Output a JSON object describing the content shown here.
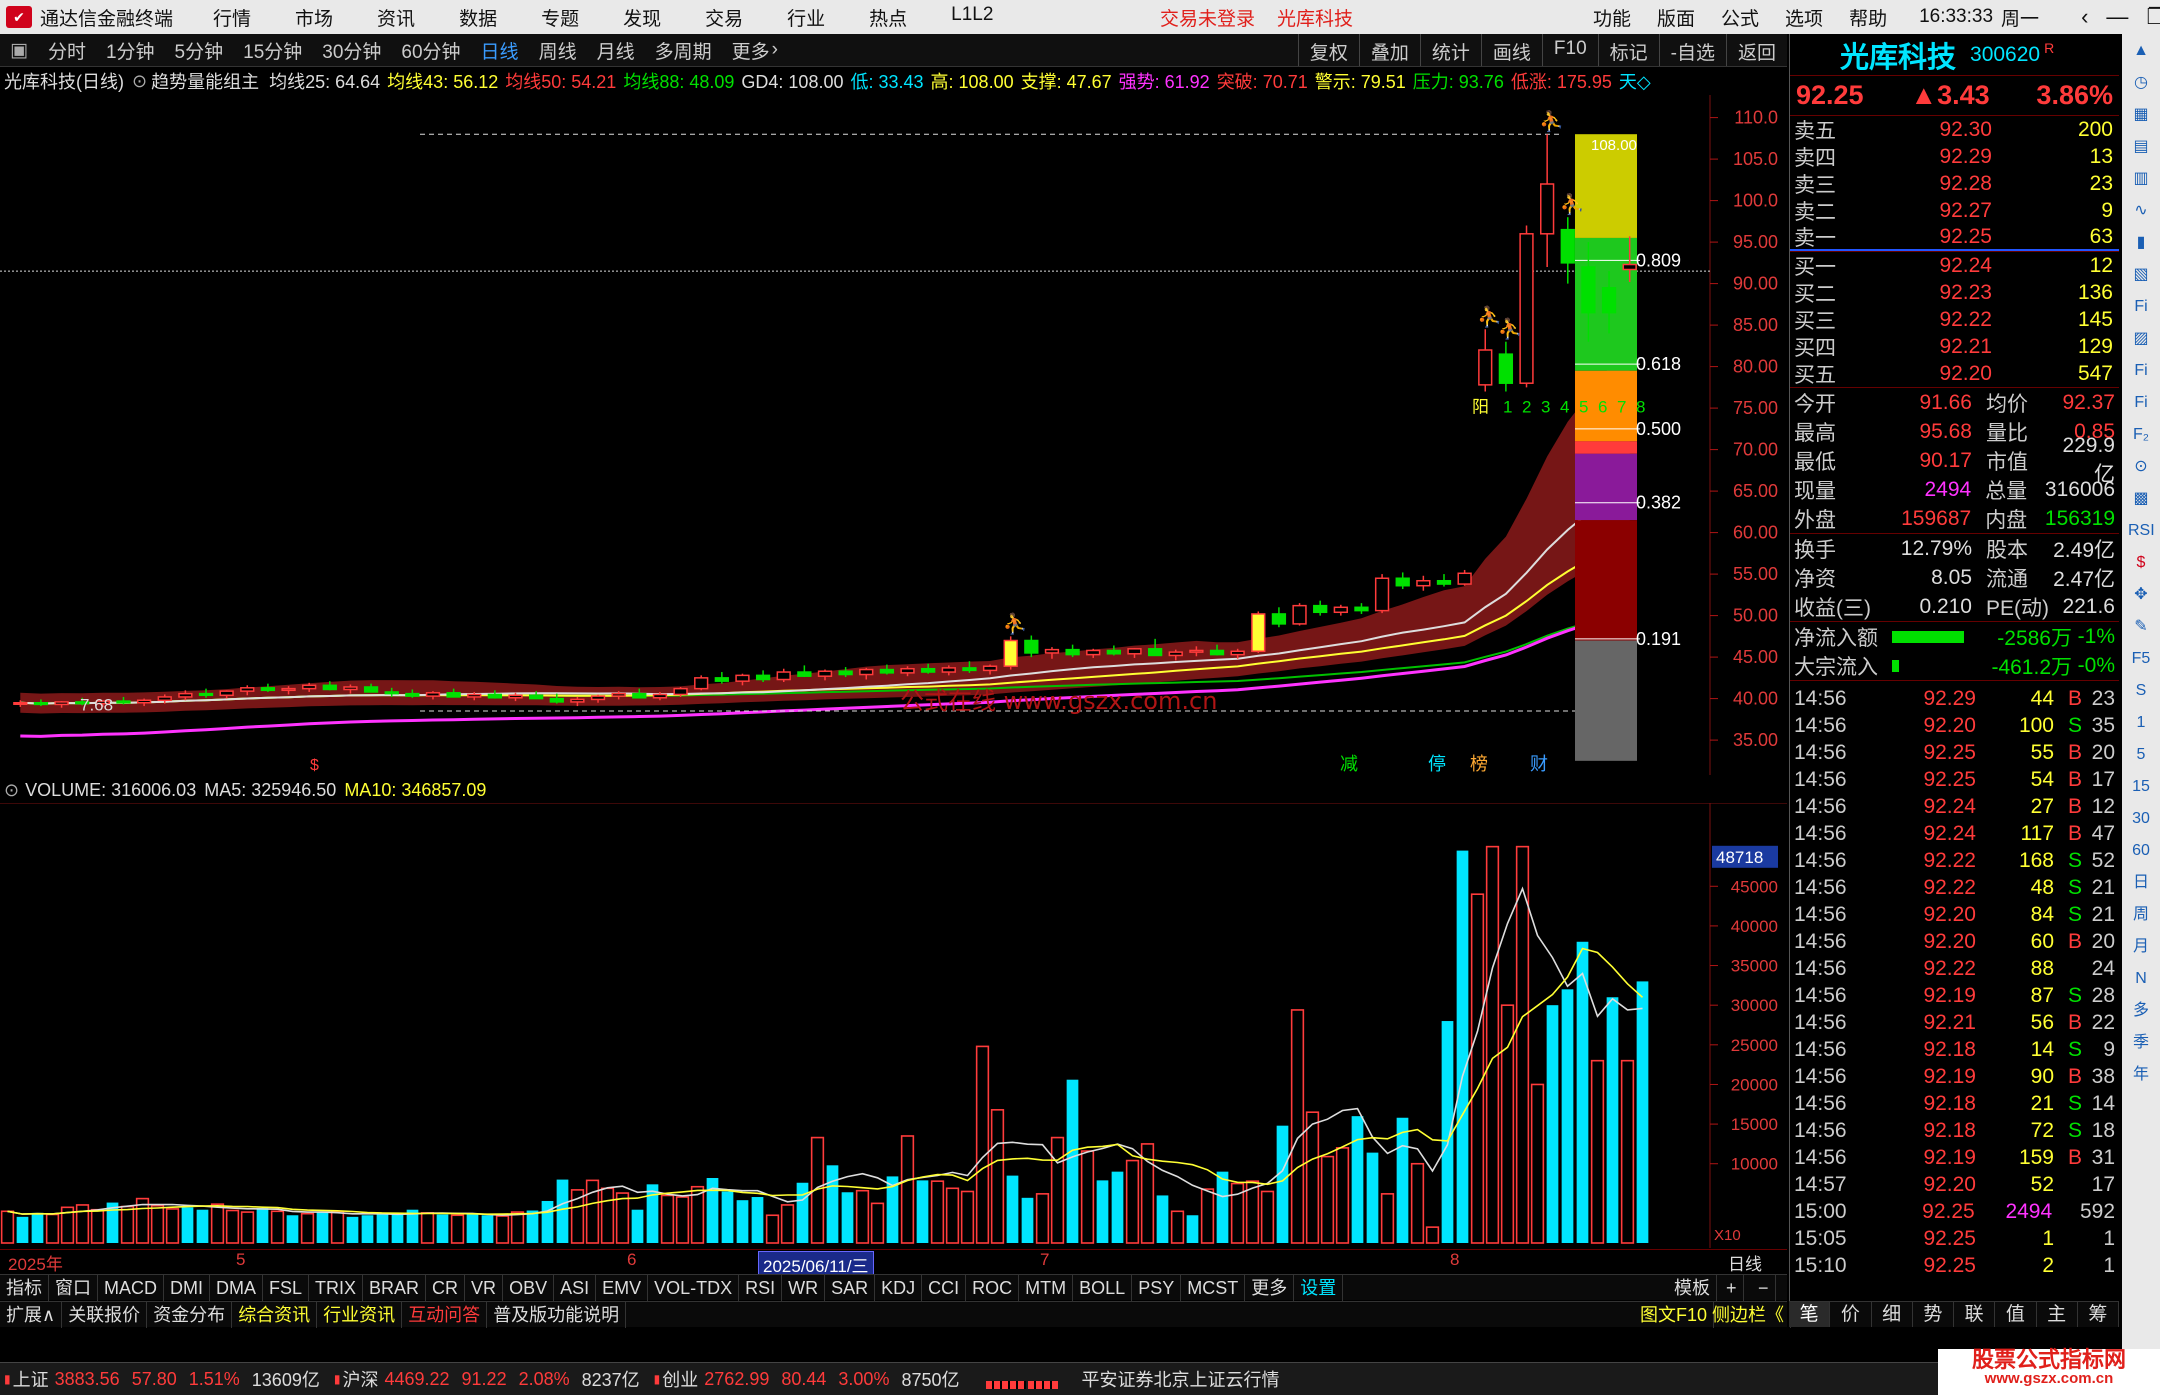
{
  "titlebar": {
    "app_title": "通达信金融终端",
    "menu": [
      "行情",
      "市场",
      "资讯",
      "数据",
      "专题",
      "发现",
      "交易",
      "行业",
      "热点",
      "L1L2"
    ],
    "status_left": "交易未登录",
    "status_right": "光库科技",
    "right_menu": [
      "功能",
      "版面",
      "公式",
      "选项",
      "帮助"
    ],
    "clock": "16:33:33",
    "weekday": "周一"
  },
  "toolbar": {
    "periods": [
      "分时",
      "1分钟",
      "5分钟",
      "15分钟",
      "30分钟",
      "60分钟",
      "日线",
      "周线",
      "月线",
      "多周期",
      "更多"
    ],
    "active_period": "日线",
    "right_buttons": [
      "复权",
      "叠加",
      "统计",
      "画线",
      "F10",
      "标记",
      "-自选",
      "返回"
    ]
  },
  "indicator_line": {
    "stock": "光库科技(日线)",
    "formula": "趋势量能组主",
    "items": [
      {
        "label": "均线25: 64.64",
        "color": "#dddddd"
      },
      {
        "label": "均线43: 56.12",
        "color": "#ffff33"
      },
      {
        "label": "均线50: 54.21",
        "color": "#ff3b3b"
      },
      {
        "label": "均线88: 48.09",
        "color": "#00e000"
      },
      {
        "label": "GD4: 108.00",
        "color": "#dddddd"
      },
      {
        "label": "低: 33.43",
        "color": "#00e5ff"
      },
      {
        "label": "高: 108.00",
        "color": "#ffff33"
      },
      {
        "label": "支撑: 47.67",
        "color": "#ffff33"
      },
      {
        "label": "强势: 61.92",
        "color": "#ff33ff"
      },
      {
        "label": "突破: 70.71",
        "color": "#ff3b3b"
      },
      {
        "label": "警示: 79.51",
        "color": "#ffff33"
      },
      {
        "label": "压力: 93.76",
        "color": "#00e000"
      },
      {
        "label": "低涨: 175.95",
        "color": "#ff3b3b"
      },
      {
        "label": "天◇",
        "color": "#00e5ff"
      }
    ]
  },
  "chart_data": [
    {
      "type": "candlestick",
      "title": "光库科技(日线)",
      "ylim": [
        32,
        112
      ],
      "y_ticks": [
        "110.0",
        "105.0",
        "100.0",
        "95.00",
        "90.00",
        "85.00",
        "80.00",
        "75.00",
        "70.00",
        "65.00",
        "60.00",
        "55.00",
        "50.00",
        "45.00",
        "40.00",
        "35.00"
      ],
      "fib_levels": [
        "0.809",
        "0.618",
        "0.500",
        "0.382",
        "0.191"
      ],
      "top_label": "108.00",
      "low_label": "7.68",
      "count_labels": [
        "阳",
        "1",
        "2",
        "3",
        "4",
        "5",
        "6",
        "7",
        "8"
      ],
      "bottom_markers": [
        "减",
        "停",
        "榜",
        "财"
      ],
      "watermark": "公式在线 www.gszx.com.cn",
      "candles": [
        [
          39.4,
          39.8,
          39.0,
          39.5
        ],
        [
          39.5,
          39.9,
          39.1,
          39.3
        ],
        [
          39.3,
          39.7,
          38.9,
          39.6
        ],
        [
          39.6,
          40.1,
          39.2,
          39.4
        ],
        [
          39.4,
          39.8,
          39.0,
          39.7
        ],
        [
          39.7,
          40.2,
          39.3,
          39.5
        ],
        [
          39.5,
          40.0,
          39.1,
          39.8
        ],
        [
          39.8,
          40.5,
          39.4,
          40.2
        ],
        [
          40.2,
          41.0,
          39.8,
          40.6
        ],
        [
          40.6,
          41.2,
          40.1,
          40.4
        ],
        [
          40.4,
          41.0,
          40.0,
          40.9
        ],
        [
          40.9,
          41.6,
          40.4,
          41.3
        ],
        [
          41.3,
          41.8,
          40.8,
          41.0
        ],
        [
          41.0,
          41.5,
          40.5,
          41.2
        ],
        [
          41.2,
          41.9,
          40.8,
          41.6
        ],
        [
          41.6,
          42.1,
          41.0,
          41.1
        ],
        [
          41.1,
          41.7,
          40.6,
          41.4
        ],
        [
          41.4,
          41.8,
          40.9,
          40.8
        ],
        [
          40.8,
          41.3,
          40.2,
          40.6
        ],
        [
          40.6,
          41.1,
          40.1,
          40.3
        ],
        [
          40.3,
          40.9,
          39.9,
          40.7
        ],
        [
          40.7,
          41.2,
          40.2,
          40.2
        ],
        [
          40.2,
          40.8,
          39.8,
          40.5
        ],
        [
          40.5,
          41.0,
          40.0,
          40.1
        ],
        [
          40.1,
          40.7,
          39.7,
          40.4
        ],
        [
          40.4,
          40.9,
          40.0,
          40.0
        ],
        [
          40.0,
          40.6,
          39.4,
          39.6
        ],
        [
          39.6,
          40.2,
          39.1,
          39.9
        ],
        [
          39.9,
          40.5,
          39.5,
          40.3
        ],
        [
          40.3,
          40.9,
          39.9,
          40.6
        ],
        [
          40.6,
          41.2,
          40.2,
          40.1
        ],
        [
          40.1,
          40.8,
          39.8,
          40.5
        ],
        [
          40.5,
          41.4,
          40.2,
          41.2
        ],
        [
          41.2,
          42.8,
          41.0,
          42.5
        ],
        [
          42.5,
          43.2,
          41.8,
          42.1
        ],
        [
          42.1,
          43.0,
          41.6,
          42.8
        ],
        [
          42.8,
          43.4,
          42.0,
          42.3
        ],
        [
          42.3,
          43.6,
          42.0,
          43.2
        ],
        [
          43.2,
          44.0,
          42.6,
          42.7
        ],
        [
          42.7,
          43.5,
          42.2,
          43.3
        ],
        [
          43.3,
          43.8,
          42.6,
          42.9
        ],
        [
          42.9,
          43.7,
          42.3,
          43.5
        ],
        [
          43.5,
          44.1,
          42.9,
          43.1
        ],
        [
          43.1,
          43.9,
          42.7,
          43.6
        ],
        [
          43.6,
          44.2,
          43.0,
          43.2
        ],
        [
          43.2,
          44.0,
          42.8,
          43.7
        ],
        [
          43.7,
          44.5,
          43.1,
          43.4
        ],
        [
          43.4,
          44.1,
          42.9,
          43.9
        ],
        [
          43.9,
          47.5,
          43.5,
          47.0
        ],
        [
          47.0,
          47.6,
          45.0,
          45.5
        ],
        [
          45.5,
          46.2,
          44.8,
          45.9
        ],
        [
          45.9,
          46.5,
          45.0,
          45.3
        ],
        [
          45.3,
          46.0,
          44.9,
          45.8
        ],
        [
          45.8,
          46.4,
          45.2,
          45.4
        ],
        [
          45.4,
          46.1,
          44.9,
          46.0
        ],
        [
          46.0,
          47.2,
          45.4,
          45.2
        ],
        [
          45.2,
          45.9,
          44.6,
          45.6
        ],
        [
          45.6,
          46.3,
          45.1,
          45.8
        ],
        [
          45.8,
          46.5,
          45.2,
          45.3
        ],
        [
          45.3,
          46.0,
          44.8,
          45.7
        ],
        [
          45.7,
          50.5,
          45.5,
          50.2
        ],
        [
          50.2,
          51.0,
          48.6,
          49.0
        ],
        [
          49.0,
          51.5,
          48.8,
          51.2
        ],
        [
          51.2,
          51.8,
          50.0,
          50.4
        ],
        [
          50.4,
          51.3,
          50.0,
          51.0
        ],
        [
          51.0,
          51.5,
          50.2,
          50.6
        ],
        [
          50.6,
          55.0,
          50.3,
          54.5
        ],
        [
          54.5,
          55.2,
          53.2,
          53.6
        ],
        [
          53.6,
          54.8,
          53.0,
          54.2
        ],
        [
          54.2,
          55.0,
          53.5,
          53.8
        ],
        [
          53.8,
          55.5,
          53.6,
          55.1
        ],
        [
          77.8,
          84.5,
          77.0,
          82.0
        ],
        [
          81.5,
          83.0,
          77.0,
          78.0
        ],
        [
          78.0,
          97.0,
          77.5,
          96.0
        ],
        [
          96.0,
          108.0,
          92.0,
          102.0
        ],
        [
          96.5,
          98.0,
          90.0,
          92.5
        ],
        [
          92.0,
          95.0,
          83.0,
          86.5
        ],
        [
          89.5,
          91.5,
          84.0,
          86.5
        ],
        [
          91.7,
          95.7,
          90.2,
          92.3
        ]
      ]
    },
    {
      "type": "bar",
      "title": "VOLUME",
      "ylim": [
        0,
        55000
      ],
      "y_ticks": [
        "45000",
        "40000",
        "35000",
        "30000",
        "25000",
        "20000",
        "15000",
        "10000"
      ],
      "current_label": "48718",
      "unit_label": "X10",
      "values": [
        4000,
        3300,
        3800,
        3600,
        4500,
        4800,
        4200,
        5100,
        4600,
        5600,
        4700,
        4300,
        4500,
        4200,
        4900,
        4100,
        3900,
        4400,
        4000,
        3500,
        3700,
        3900,
        4000,
        3300,
        3500,
        3700,
        3600,
        4200,
        3800,
        3600,
        3500,
        3600,
        3500,
        3400,
        3900,
        4100,
        5300,
        8000,
        6700,
        7900,
        6900,
        6300,
        4200,
        7400,
        6000,
        5800,
        7100,
        8200,
        6500,
        5400,
        5800,
        3500,
        4800,
        7600,
        13300,
        9800,
        6400,
        6600,
        5000,
        8400,
        13500,
        7900,
        7800,
        6900,
        6500,
        24800,
        16800,
        8500,
        5700,
        6200,
        13300,
        20600,
        11600,
        7900,
        9000,
        10400,
        12500,
        6000,
        4000,
        3500,
        6800,
        9000,
        7500,
        7800,
        6500,
        14800,
        29400,
        16500,
        10900,
        12000,
        16000,
        11400,
        6200,
        15800,
        10000,
        2000,
        28000,
        49500,
        44000,
        50000,
        30000,
        50000,
        20000,
        30000,
        32000,
        38000,
        23000,
        31000,
        23000,
        33000
      ],
      "series_colors": [
        "#ff3b3b",
        "#00e5ff"
      ]
    }
  ],
  "vol_header": {
    "label": "VOLUME: 316006.03",
    "ma5": "MA5: 325946.50",
    "ma10": "MA10: 346857.09"
  },
  "datebar": {
    "year": "2025年",
    "m5": "5",
    "m6": "6",
    "date_box": "2025/06/11/三",
    "m7": "7",
    "m8": "8",
    "period": "日线",
    "flag": "$"
  },
  "tabs1": [
    "指标",
    "窗口",
    "MACD",
    "DMI",
    "DMA",
    "FSL",
    "TRIX",
    "BRAR",
    "CR",
    "VR",
    "OBV",
    "ASI",
    "EMV",
    "VOL-TDX",
    "RSI",
    "WR",
    "SAR",
    "KDJ",
    "CCI",
    "ROC",
    "MTM",
    "BOLL",
    "PSY",
    "MCST",
    "更多",
    "设置"
  ],
  "tabs1_right": [
    "模板",
    "+",
    "−"
  ],
  "tabs2": [
    "扩展∧",
    "关联报价",
    "资金分布",
    "综合资讯",
    "行业资讯",
    "互动问答",
    "普及版功能说明"
  ],
  "tabs2_right": [
    "图文F10",
    "侧边栏《"
  ],
  "quote": {
    "name": "光库科技",
    "code": "300620",
    "badge": "R",
    "price": "92.25",
    "change": "▲3.43",
    "pct": "3.86%",
    "asks": [
      {
        "label": "卖五",
        "price": "92.30",
        "vol": "200"
      },
      {
        "label": "卖四",
        "price": "92.29",
        "vol": "13"
      },
      {
        "label": "卖三",
        "price": "92.28",
        "vol": "23"
      },
      {
        "label": "卖二",
        "price": "92.27",
        "vol": "9"
      },
      {
        "label": "卖一",
        "price": "92.25",
        "vol": "63"
      }
    ],
    "bids": [
      {
        "label": "买一",
        "price": "92.24",
        "vol": "12"
      },
      {
        "label": "买二",
        "price": "92.23",
        "vol": "136"
      },
      {
        "label": "买三",
        "price": "92.22",
        "vol": "145"
      },
      {
        "label": "买四",
        "price": "92.21",
        "vol": "129"
      },
      {
        "label": "买五",
        "price": "92.20",
        "vol": "547"
      }
    ],
    "stats1": [
      {
        "k": "今开",
        "v": "91.66",
        "vc": "#ff3b3b",
        "k2": "均价",
        "v2": "92.37",
        "v2c": "#ff3b3b"
      },
      {
        "k": "最高",
        "v": "95.68",
        "vc": "#ff3b3b",
        "k2": "量比",
        "v2": "0.85",
        "v2c": "#ff3b3b"
      },
      {
        "k": "最低",
        "v": "90.17",
        "vc": "#ff3b3b",
        "k2": "市值",
        "v2": "229.9亿",
        "v2c": "#dddddd"
      },
      {
        "k": "现量",
        "v": "2494",
        "vc": "#ff33ff",
        "k2": "总量",
        "v2": "316006",
        "v2c": "#dddddd"
      },
      {
        "k": "外盘",
        "v": "159687",
        "vc": "#ff3b3b",
        "k2": "内盘",
        "v2": "156319",
        "v2c": "#00e000"
      }
    ],
    "stats2": [
      {
        "k": "换手",
        "v": "12.79%",
        "vc": "#dddddd",
        "k2": "股本",
        "v2": "2.49亿",
        "v2c": "#dddddd"
      },
      {
        "k": "净资",
        "v": "8.05",
        "vc": "#dddddd",
        "k2": "流通",
        "v2": "2.47亿",
        "v2c": "#dddddd"
      },
      {
        "k": "收益(三)",
        "v": "0.210",
        "vc": "#dddddd",
        "k2": "PE(动)",
        "v2": "221.6",
        "v2c": "#dddddd"
      }
    ],
    "flows": [
      {
        "k": "净流入额",
        "v": "-2586万",
        "pct": "-1%",
        "bar": 0.8
      },
      {
        "k": "大宗流入",
        "v": "-461.2万",
        "pct": "-0%",
        "bar": 0.08
      }
    ],
    "ticks": [
      {
        "t": "14:56",
        "p": "92.29",
        "q": "44",
        "s": "B",
        "n": "23"
      },
      {
        "t": "14:56",
        "p": "92.20",
        "q": "100",
        "s": "S",
        "n": "35"
      },
      {
        "t": "14:56",
        "p": "92.25",
        "q": "55",
        "s": "B",
        "n": "20"
      },
      {
        "t": "14:56",
        "p": "92.25",
        "q": "54",
        "s": "B",
        "n": "17"
      },
      {
        "t": "14:56",
        "p": "92.24",
        "q": "27",
        "s": "B",
        "n": "12"
      },
      {
        "t": "14:56",
        "p": "92.24",
        "q": "117",
        "s": "B",
        "n": "47"
      },
      {
        "t": "14:56",
        "p": "92.22",
        "q": "168",
        "s": "S",
        "n": "52"
      },
      {
        "t": "14:56",
        "p": "92.22",
        "q": "48",
        "s": "S",
        "n": "21"
      },
      {
        "t": "14:56",
        "p": "92.20",
        "q": "84",
        "s": "S",
        "n": "21"
      },
      {
        "t": "14:56",
        "p": "92.20",
        "q": "60",
        "s": "B",
        "n": "20"
      },
      {
        "t": "14:56",
        "p": "92.22",
        "q": "88",
        "s": "",
        "n": "24"
      },
      {
        "t": "14:56",
        "p": "92.19",
        "q": "87",
        "s": "S",
        "n": "28"
      },
      {
        "t": "14:56",
        "p": "92.21",
        "q": "56",
        "s": "B",
        "n": "22"
      },
      {
        "t": "14:56",
        "p": "92.18",
        "q": "14",
        "s": "S",
        "n": "9"
      },
      {
        "t": "14:56",
        "p": "92.19",
        "q": "90",
        "s": "B",
        "n": "38"
      },
      {
        "t": "14:56",
        "p": "92.18",
        "q": "21",
        "s": "S",
        "n": "14"
      },
      {
        "t": "14:56",
        "p": "92.18",
        "q": "72",
        "s": "S",
        "n": "18"
      },
      {
        "t": "14:56",
        "p": "92.19",
        "q": "159",
        "s": "B",
        "n": "31"
      },
      {
        "t": "14:57",
        "p": "92.20",
        "q": "52",
        "s": "",
        "n": "17"
      },
      {
        "t": "15:00",
        "p": "92.25",
        "q": "2494",
        "s": "",
        "n": "592"
      },
      {
        "t": "15:05",
        "p": "92.25",
        "q": "1",
        "s": "",
        "n": "1"
      },
      {
        "t": "15:10",
        "p": "92.25",
        "q": "2",
        "s": "",
        "n": "1"
      }
    ],
    "tabs": [
      "笔",
      "价",
      "细",
      "势",
      "联",
      "值",
      "主",
      "筹"
    ]
  },
  "statusbar": {
    "items": [
      {
        "name": "上证",
        "val": "3883.56",
        "chg": "57.80",
        "pct": "1.51%",
        "amt": "13609亿"
      },
      {
        "name": "沪深",
        "val": "4469.22",
        "chg": "91.22",
        "pct": "2.08%",
        "amt": "8237亿"
      },
      {
        "name": "创业",
        "val": "2762.99",
        "chg": "80.44",
        "pct": "3.00%",
        "amt": "8750亿"
      }
    ],
    "server": "平安证券北京上证云行情",
    "brand_line1": "股票公式指标网",
    "brand_line2": "www.gszx.com.cn"
  },
  "iconbar": [
    "▲",
    "◷",
    "▦",
    "▤",
    "▥",
    "∿",
    "▮",
    "▧",
    "Fi",
    "▨",
    "Fi",
    "Fi",
    "F₂",
    "⊙",
    "▩",
    "RSI",
    "$",
    "✥",
    "✎",
    "F5",
    "S",
    "1",
    "5",
    "15",
    "30",
    "60",
    "日",
    "周",
    "月",
    "N",
    "多",
    "季",
    "年"
  ]
}
